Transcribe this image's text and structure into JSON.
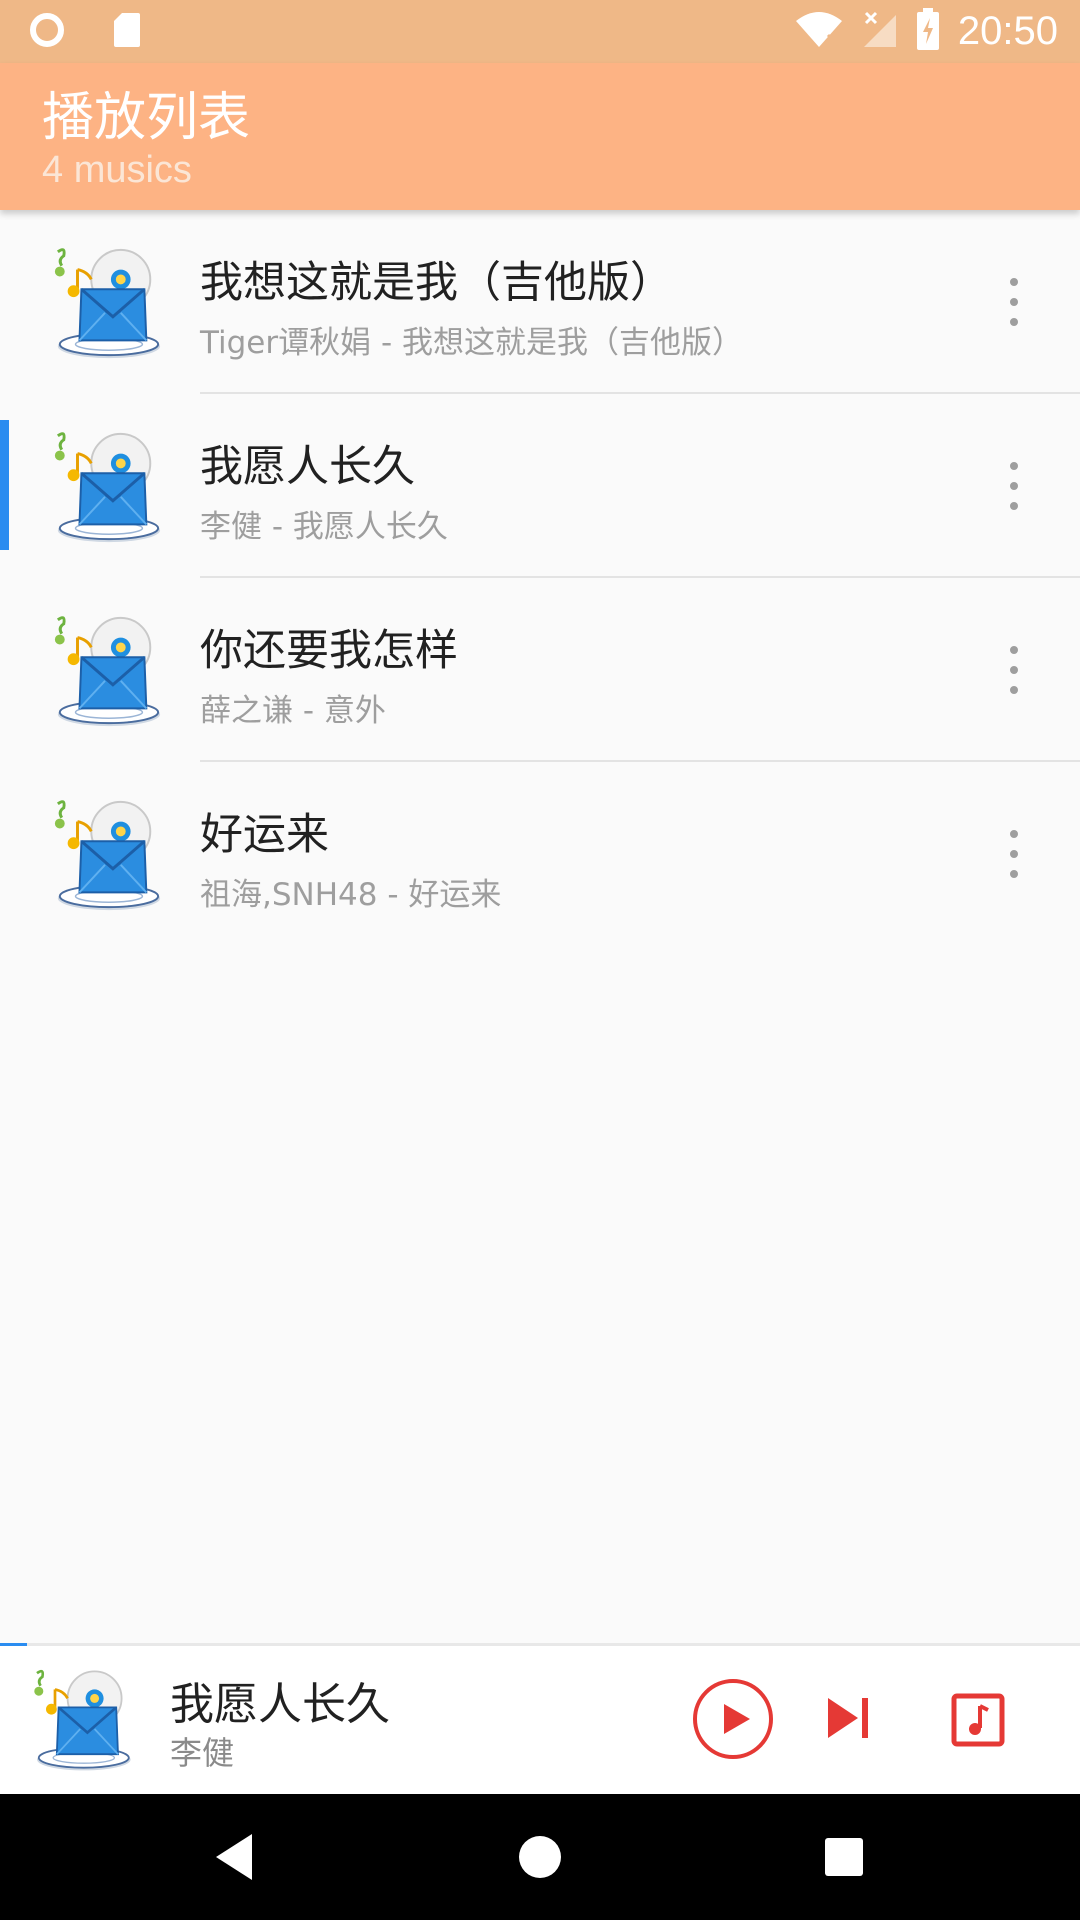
{
  "status_bar": {
    "time": "20:50",
    "icons": [
      "circle-notification-icon",
      "sd-card-icon",
      "wifi-off-icon",
      "signal-off-icon",
      "battery-charging-icon"
    ]
  },
  "toolbar": {
    "title": "播放列表",
    "subtitle": "4 musics",
    "color": "#fdb384"
  },
  "playlist": {
    "items": [
      {
        "title": "我想这就是我（吉他版）",
        "subtitle": "Tiger谭秋娟 - 我想这就是我（吉他版）",
        "active": false
      },
      {
        "title": "我愿人长久",
        "subtitle": "李健 - 我愿人长久",
        "active": true
      },
      {
        "title": "你还要我怎样",
        "subtitle": "薛之谦 - 意外",
        "active": false
      },
      {
        "title": "好运来",
        "subtitle": "祖海,SNH48 - 好运来",
        "active": false
      }
    ],
    "active_indicator_color": "#2a8cf0",
    "item_icon": "music-album-icon",
    "more_icon": "more-vertical-icon"
  },
  "mini_player": {
    "title": "我愿人长久",
    "artist": "李健",
    "progress_fraction": 0.025,
    "accent_color": "#e53935",
    "controls": [
      "play-icon",
      "skip-next-icon",
      "playlist-music-icon"
    ]
  },
  "nav_bar": {
    "buttons": [
      "back-icon",
      "home-icon",
      "recents-icon"
    ]
  }
}
